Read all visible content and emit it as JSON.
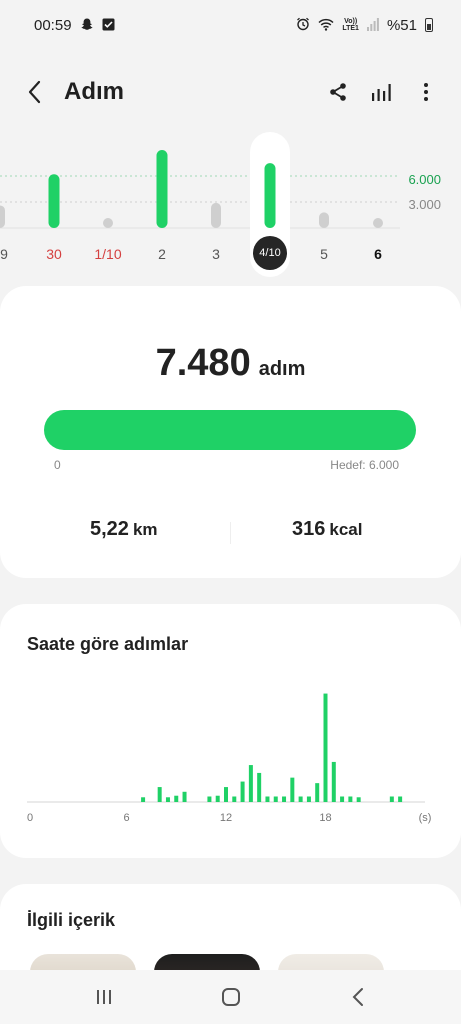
{
  "status_bar": {
    "time": "00:59",
    "lte_top": "Vo))",
    "lte_bottom": "LTE1",
    "battery": "%51",
    "icons": [
      "snapchat-icon",
      "check-box-icon",
      "alarm-icon",
      "wifi-icon",
      "signal-icon",
      "battery-icon"
    ]
  },
  "header": {
    "title": "Adım",
    "actions": [
      "share-icon",
      "stats-icon",
      "more-icon"
    ]
  },
  "week_chart": {
    "goal_high": "6.000",
    "goal_low": "3.000",
    "days": [
      "9",
      "30",
      "1/10",
      "2",
      "3",
      "4/10",
      "5",
      "6"
    ],
    "selected": "4/10",
    "steps": [
      2600,
      6200,
      700,
      9000,
      2900,
      7480,
      1800,
      700
    ],
    "colors": {
      "met": "#1fd166",
      "unmet": "#cfcfcf"
    }
  },
  "summary": {
    "steps_value": "7.480",
    "steps_unit": "adım",
    "progress_percent": 100,
    "min_label": "0",
    "goal_label": "Hedef: 6.000",
    "distance_value": "5,22",
    "distance_unit": "km",
    "calories_value": "316",
    "calories_unit": "kcal"
  },
  "hourly": {
    "title": "Saate göre adımlar",
    "ticks": [
      "0",
      "6",
      "12",
      "18",
      "(s)"
    ],
    "chart_data": {
      "type": "bar",
      "x": [
        7,
        8,
        8.5,
        9,
        9.5,
        11,
        11.5,
        12,
        12.5,
        13,
        13.5,
        14,
        14.5,
        15,
        15.5,
        16,
        16.5,
        17,
        17.5,
        18,
        18.5,
        19,
        19.5,
        20,
        22,
        22.5
      ],
      "values": [
        60,
        190,
        60,
        80,
        130,
        70,
        80,
        190,
        70,
        260,
        470,
        370,
        70,
        70,
        70,
        310,
        70,
        70,
        240,
        1380,
        510,
        70,
        70,
        60,
        70,
        70
      ],
      "color": "#1fd166"
    }
  },
  "related": {
    "title": "İlgili içerik"
  },
  "nav": [
    "recents-icon",
    "home-icon",
    "back-nav-icon"
  ]
}
